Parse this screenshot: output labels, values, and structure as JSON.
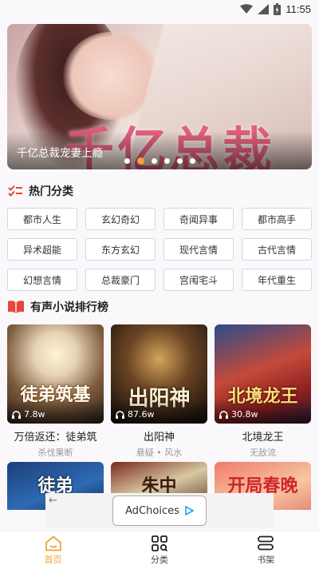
{
  "status_bar": {
    "time": "11:55"
  },
  "banner": {
    "caption": "千亿总裁宠妻上瘾",
    "art_text": "千亿总裁",
    "dots_total": 6,
    "active_dot": 1
  },
  "categories": {
    "title": "热门分类",
    "items": [
      "都市人生",
      "玄幻奇幻",
      "奇闻异事",
      "都市高手",
      "异术超能",
      "东方玄幻",
      "现代言情",
      "古代言情",
      "幻想言情",
      "总裁豪门",
      "宫闱宅斗",
      "年代重生"
    ]
  },
  "ranking": {
    "title": "有声小说排行榜",
    "books": [
      {
        "cover_text": "徒弟筑基",
        "plays": "7.8w",
        "name": "万倍返还：徒弟筑",
        "sub": "杀伐果断"
      },
      {
        "cover_text": "出阳神",
        "plays": "87.6w",
        "name": "出阳神",
        "sub": "悬疑 • 风水"
      },
      {
        "cover_text": "北境龙王",
        "plays": "30.8w",
        "name": "北境龙王",
        "sub": "无敌流"
      }
    ],
    "more_covers": [
      "徒弟",
      "朱中",
      "开局春晚"
    ]
  },
  "ad": {
    "label": "AdChoices"
  },
  "tabbar": {
    "items": [
      {
        "label": "首页",
        "icon": "home-icon",
        "active": true
      },
      {
        "label": "分类",
        "icon": "category-icon",
        "active": false
      },
      {
        "label": "书架",
        "icon": "bookshelf-icon",
        "active": false
      }
    ]
  },
  "colors": {
    "accent": "#f0a23b",
    "banner_text": "#e35a7a",
    "section_icon_red": "#e8463a"
  }
}
